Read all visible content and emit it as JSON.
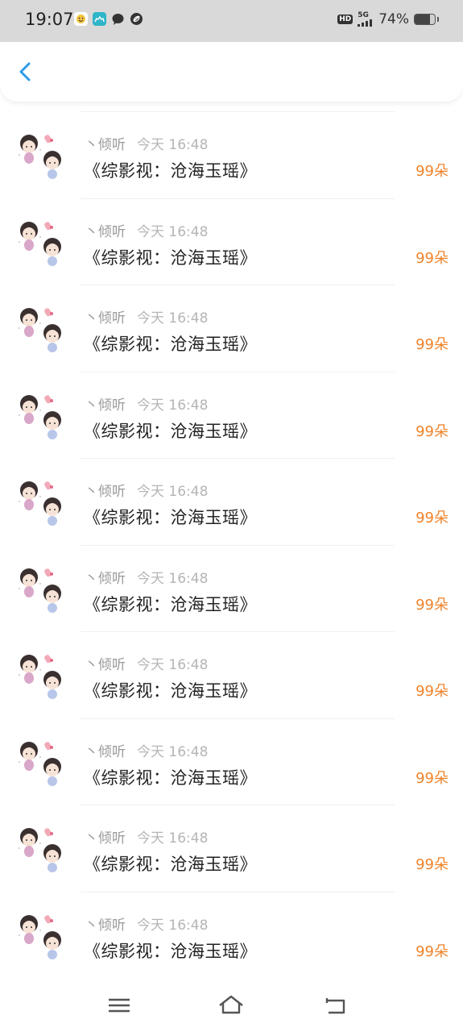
{
  "status_bar": {
    "time": "19:07",
    "hd": "HD",
    "network": "5G",
    "battery_percent": "74%",
    "battery_level": 0.74
  },
  "header": {
    "back_icon": "chevron-left-icon",
    "accent_color": "#2f9be8"
  },
  "gift_list": {
    "items": [
      {
        "user_name": "丶倾听",
        "time": "今天 16:48",
        "title": "《综影视：沧海玉瑶》",
        "count": "99朵"
      },
      {
        "user_name": "丶倾听",
        "time": "今天 16:48",
        "title": "《综影视：沧海玉瑶》",
        "count": "99朵"
      },
      {
        "user_name": "丶倾听",
        "time": "今天 16:48",
        "title": "《综影视：沧海玉瑶》",
        "count": "99朵"
      },
      {
        "user_name": "丶倾听",
        "time": "今天 16:48",
        "title": "《综影视：沧海玉瑶》",
        "count": "99朵"
      },
      {
        "user_name": "丶倾听",
        "time": "今天 16:48",
        "title": "《综影视：沧海玉瑶》",
        "count": "99朵"
      },
      {
        "user_name": "丶倾听",
        "time": "今天 16:48",
        "title": "《综影视：沧海玉瑶》",
        "count": "99朵"
      },
      {
        "user_name": "丶倾听",
        "time": "今天 16:48",
        "title": "《综影视：沧海玉瑶》",
        "count": "99朵"
      },
      {
        "user_name": "丶倾听",
        "time": "今天 16:48",
        "title": "《综影视：沧海玉瑶》",
        "count": "99朵"
      },
      {
        "user_name": "丶倾听",
        "time": "今天 16:48",
        "title": "《综影视：沧海玉瑶》",
        "count": "99朵"
      },
      {
        "user_name": "丶倾听",
        "time": "今天 16:48",
        "title": "《综影视：沧海玉瑶》",
        "count": "99朵"
      }
    ],
    "count_color": "#f0832a"
  },
  "nav_bar": {
    "menu_icon": "menu-icon",
    "home_icon": "home-icon",
    "back_icon": "back-icon"
  }
}
